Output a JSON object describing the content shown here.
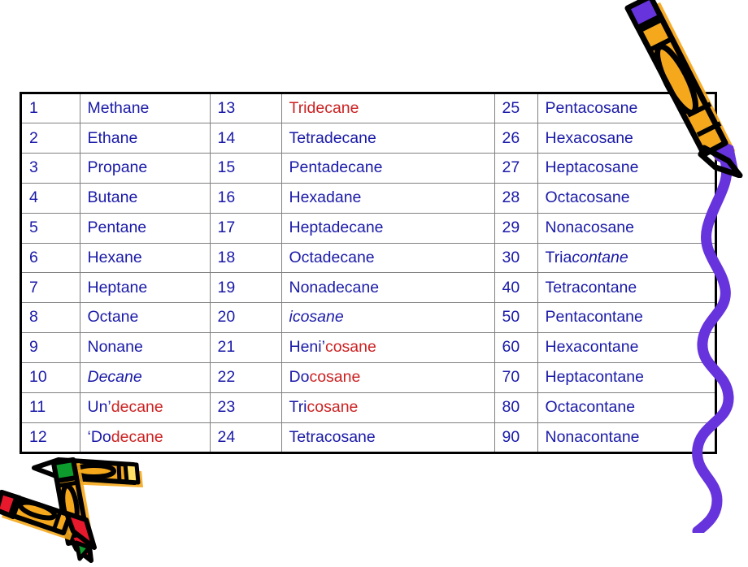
{
  "slide": {
    "background_color": "#ffffff",
    "text_color_primary": "#1a1aa8",
    "text_color_accent": "#cc2222",
    "crayon_body_color": "#f5a81c",
    "crayon_tip_purple": "#6633dd",
    "crayon_tip_green": "#0d9b2e",
    "crayon_tip_red": "#e8192c",
    "crayon_tip_yellow": "#ffe066",
    "squiggle_color": "#6633dd",
    "table_border_color": "#000000",
    "table_gridline_color": "#808080"
  },
  "table": {
    "name": "alkane-nomenclature-table",
    "columns": 6,
    "rows": [
      {
        "num_a": "1",
        "name_a": [
          {
            "text": "Methane",
            "color": "blue",
            "italic": false
          }
        ],
        "num_b": "13",
        "name_b": [
          {
            "text": "Tridecane",
            "color": "red",
            "italic": false
          }
        ],
        "num_c": "25",
        "name_c": [
          {
            "text": "Pentacosane",
            "color": "blue",
            "italic": false
          }
        ]
      },
      {
        "num_a": "2",
        "name_a": [
          {
            "text": "Ethane",
            "color": "blue",
            "italic": false
          }
        ],
        "num_b": "14",
        "name_b": [
          {
            "text": "Tetradecane",
            "color": "blue",
            "italic": false
          }
        ],
        "num_c": "26",
        "name_c": [
          {
            "text": "Hexacosane",
            "color": "blue",
            "italic": false
          }
        ]
      },
      {
        "num_a": "3",
        "name_a": [
          {
            "text": "Propane",
            "color": "blue",
            "italic": false
          }
        ],
        "num_b": "15",
        "name_b": [
          {
            "text": "Pentadecane",
            "color": "blue",
            "italic": false
          }
        ],
        "num_c": "27",
        "name_c": [
          {
            "text": "Heptacosane",
            "color": "blue",
            "italic": false
          }
        ]
      },
      {
        "num_a": "4",
        "name_a": [
          {
            "text": "Butane",
            "color": "blue",
            "italic": false
          }
        ],
        "num_b": "16",
        "name_b": [
          {
            "text": "Hexadane",
            "color": "blue",
            "italic": false
          }
        ],
        "num_c": "28",
        "name_c": [
          {
            "text": "Octacosane",
            "color": "blue",
            "italic": false
          }
        ]
      },
      {
        "num_a": "5",
        "name_a": [
          {
            "text": "Pentane",
            "color": "blue",
            "italic": false
          }
        ],
        "num_b": "17",
        "name_b": [
          {
            "text": "Heptadecane",
            "color": "blue",
            "italic": false
          }
        ],
        "num_c": "29",
        "name_c": [
          {
            "text": "Nonacosane",
            "color": "blue",
            "italic": false
          }
        ]
      },
      {
        "num_a": "6",
        "name_a": [
          {
            "text": "Hexane",
            "color": "blue",
            "italic": false
          }
        ],
        "num_b": "18",
        "name_b": [
          {
            "text": "Octadecane",
            "color": "blue",
            "italic": false
          }
        ],
        "num_c": "30",
        "name_c": [
          {
            "text": "Tria",
            "color": "blue",
            "italic": false
          },
          {
            "text": "contane",
            "color": "blue",
            "italic": true
          }
        ]
      },
      {
        "num_a": "7",
        "name_a": [
          {
            "text": "Heptane",
            "color": "blue",
            "italic": false
          }
        ],
        "num_b": "19",
        "name_b": [
          {
            "text": "Nonadecane",
            "color": "blue",
            "italic": false
          }
        ],
        "num_c": "40",
        "name_c": [
          {
            "text": "Tetracontane",
            "color": "blue",
            "italic": false
          }
        ]
      },
      {
        "num_a": "8",
        "name_a": [
          {
            "text": "Octane",
            "color": "blue",
            "italic": false
          }
        ],
        "num_b": "20",
        "name_b": [
          {
            "text": "icosane",
            "color": "blue",
            "italic": true
          }
        ],
        "num_c": "50",
        "name_c": [
          {
            "text": "Pentacontane",
            "color": "blue",
            "italic": false
          }
        ]
      },
      {
        "num_a": "9",
        "name_a": [
          {
            "text": "Nonane",
            "color": "blue",
            "italic": false
          }
        ],
        "num_b": "21",
        "name_b": [
          {
            "text": "Heni’",
            "color": "blue",
            "italic": false
          },
          {
            "text": "cosane",
            "color": "red",
            "italic": false
          }
        ],
        "num_c": "60",
        "name_c": [
          {
            "text": "Hexacontane",
            "color": "blue",
            "italic": false
          }
        ]
      },
      {
        "num_a": "10",
        "name_a": [
          {
            "text": "Decane",
            "color": "blue",
            "italic": true
          }
        ],
        "num_b": "22",
        "name_b": [
          {
            "text": "Do",
            "color": "blue",
            "italic": false
          },
          {
            "text": "cosane",
            "color": "red",
            "italic": false
          }
        ],
        "num_c": "70",
        "name_c": [
          {
            "text": "Heptacontane",
            "color": "blue",
            "italic": false
          }
        ]
      },
      {
        "num_a": "11",
        "name_a": [
          {
            "text": "Un’",
            "color": "blue",
            "italic": false
          },
          {
            "text": "decane",
            "color": "red",
            "italic": false
          }
        ],
        "num_b": "23",
        "name_b": [
          {
            "text": "Tri",
            "color": "blue",
            "italic": false
          },
          {
            "text": "cosane",
            "color": "red",
            "italic": false
          }
        ],
        "num_c": "80",
        "name_c": [
          {
            "text": "Octacontane",
            "color": "blue",
            "italic": false
          }
        ]
      },
      {
        "num_a": "12",
        "name_a": [
          {
            "text": "‘Do",
            "color": "blue",
            "italic": false
          },
          {
            "text": "decane",
            "color": "red",
            "italic": false
          }
        ],
        "num_b": "24",
        "name_b": [
          {
            "text": "Tetracosane",
            "color": "blue",
            "italic": false
          }
        ],
        "num_c": "90",
        "name_c": [
          {
            "text": "Nonacontane",
            "color": "blue",
            "italic": false
          }
        ]
      }
    ]
  },
  "decorations": [
    {
      "name": "crayon-top-right",
      "description": "yellow crayon with purple tip, pointing down-right"
    },
    {
      "name": "squiggle-right",
      "description": "purple wavy crayon stroke along right edge"
    },
    {
      "name": "crayons-bottom-left",
      "description": "three crossed crayons with green, yellow and red tips"
    }
  ]
}
